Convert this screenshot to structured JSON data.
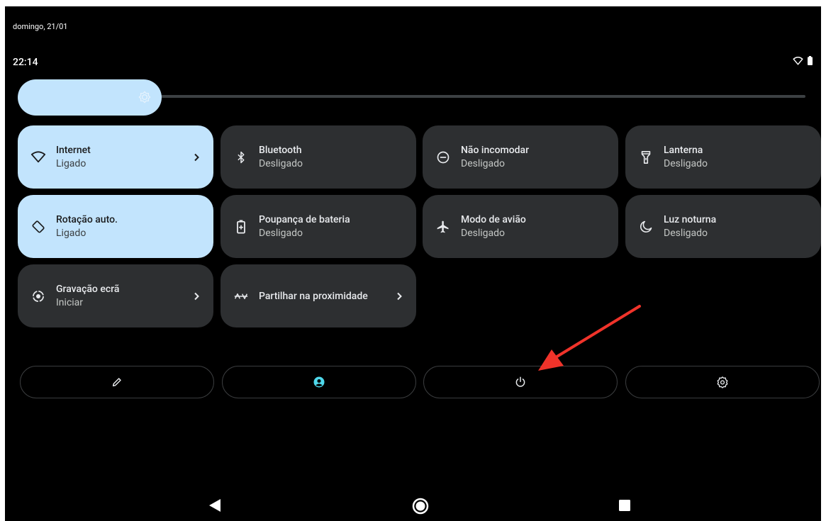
{
  "status": {
    "date": "domingo, 21/01",
    "time": "22:14"
  },
  "brightness": {
    "level": 0.18
  },
  "tiles": [
    {
      "label": "Internet",
      "state": "Ligado",
      "on": true,
      "chevron": true,
      "icon": "wifi-icon"
    },
    {
      "label": "Bluetooth",
      "state": "Desligado",
      "on": false,
      "chevron": false,
      "icon": "bluetooth-icon"
    },
    {
      "label": "Não incomodar",
      "state": "Desligado",
      "on": false,
      "chevron": false,
      "icon": "do-not-disturb-icon"
    },
    {
      "label": "Lanterna",
      "state": "Desligado",
      "on": false,
      "chevron": false,
      "icon": "flashlight-icon"
    },
    {
      "label": "Rotação auto.",
      "state": "Ligado",
      "on": true,
      "chevron": false,
      "icon": "auto-rotate-icon"
    },
    {
      "label": "Poupança de bateria",
      "state": "Desligado",
      "on": false,
      "chevron": false,
      "icon": "battery-saver-icon"
    },
    {
      "label": "Modo de avião",
      "state": "Desligado",
      "on": false,
      "chevron": false,
      "icon": "airplane-icon"
    },
    {
      "label": "Luz noturna",
      "state": "Desligado",
      "on": false,
      "chevron": false,
      "icon": "night-light-icon"
    },
    {
      "label": "Gravação ecrã",
      "state": "Iniciar",
      "on": false,
      "chevron": true,
      "icon": "screen-record-icon"
    },
    {
      "label": "Partilhar na proximidade",
      "state": "",
      "on": false,
      "chevron": true,
      "icon": "nearby-share-icon"
    }
  ],
  "buttons": [
    "edit-icon",
    "user-account-icon",
    "power-icon",
    "settings-icon"
  ],
  "colors": {
    "tile_on": "#c2e4fd",
    "tile_off": "#2d2f31",
    "accent": "#4fd8eb",
    "annotation_arrow": "#f0332a"
  }
}
